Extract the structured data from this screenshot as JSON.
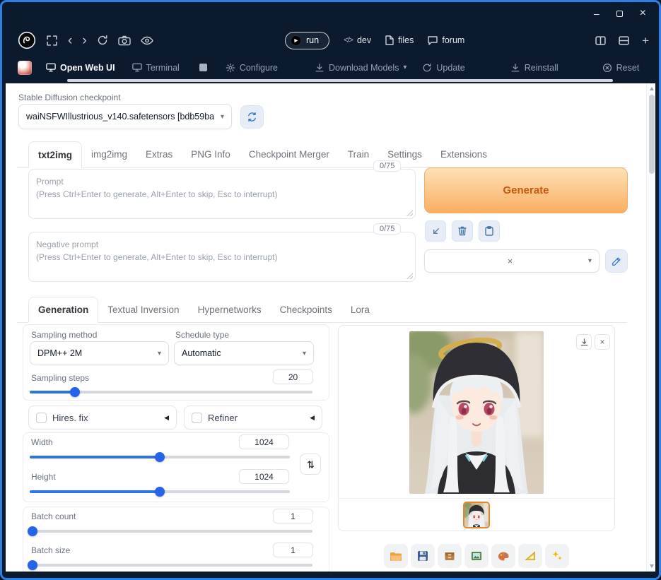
{
  "nav": {
    "run_label": "run",
    "dev_label": "dev",
    "files_label": "files",
    "forum_label": "forum"
  },
  "launcher_tabs": {
    "open_web_ui": "Open Web UI",
    "terminal": "Terminal",
    "configure": "Configure",
    "download_models": "Download Models",
    "update": "Update",
    "reinstall": "Reinstall",
    "reset": "Reset"
  },
  "quicksettings": {
    "checkpoint_label": "Stable Diffusion checkpoint",
    "checkpoint_value": "waiNSFWIllustrious_v140.safetensors [bdb59ba"
  },
  "main_tabs": [
    "txt2img",
    "img2img",
    "Extras",
    "PNG Info",
    "Checkpoint Merger",
    "Train",
    "Settings",
    "Extensions"
  ],
  "prompt": {
    "counter": "0/75",
    "title": "Prompt",
    "hint": "(Press Ctrl+Enter to generate, Alt+Enter to skip, Esc to interrupt)"
  },
  "negative_prompt": {
    "counter": "0/75",
    "title": "Negative prompt",
    "hint": "(Press Ctrl+Enter to generate, Alt+Enter to skip, Esc to interrupt)"
  },
  "generate_label": "Generate",
  "sub_tabs": [
    "Generation",
    "Textual Inversion",
    "Hypernetworks",
    "Checkpoints",
    "Lora"
  ],
  "generation": {
    "sampling_method_label": "Sampling method",
    "sampling_method_value": "DPM++ 2M",
    "schedule_type_label": "Schedule type",
    "schedule_type_value": "Automatic",
    "sampling_steps_label": "Sampling steps",
    "sampling_steps_value": "20",
    "sampling_steps_pct": 16,
    "hires_fix_label": "Hires. fix",
    "refiner_label": "Refiner",
    "width_label": "Width",
    "width_value": "1024",
    "width_pct": 50,
    "height_label": "Height",
    "height_value": "1024",
    "height_pct": 50,
    "batch_count_label": "Batch count",
    "batch_count_value": "1",
    "batch_count_pct": 1,
    "batch_size_label": "Batch size",
    "batch_size_value": "1",
    "batch_size_pct": 1
  },
  "glyphs": {
    "minimize": "–",
    "close": "×",
    "back": "‹",
    "forward": "›",
    "plus": "+",
    "code": "</>",
    "caret": "▾",
    "accordion": "◀",
    "clear": "×",
    "thumb_close": "×"
  },
  "colors": {
    "accent_blue": "#2d72e8",
    "generate_text": "#c7590f",
    "generate_gradient_top": "#fde1b6",
    "generate_gradient_bottom": "#f9ae62",
    "window_border": "#2f7fe0",
    "thumbnail_border": "#e8862e",
    "chrome_background": "#0b1a2c"
  }
}
